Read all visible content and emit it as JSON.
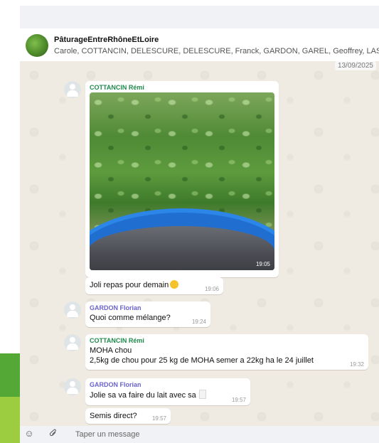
{
  "header": {
    "group_name": "PâturageEntreRhôneEtLoire",
    "members": "Carole, COTTANCIN, DELESCURE, DELESCURE, Franck, GARDON, GAREL, Geoffrey, LASS"
  },
  "chat": {
    "date": "13/09/2025",
    "messages": [
      {
        "sender": "COTTANCIN Rémi",
        "sender_color": "#1f8a4c",
        "photo_time": "19:05"
      },
      {
        "text": "Joli repas pour demain",
        "emoji": "sad-face-emoji",
        "time": "19:06"
      },
      {
        "sender": "GARDON Florian",
        "sender_color": "#6b63c9",
        "text": "Quoi comme mélange?",
        "time": "19:24"
      },
      {
        "sender": "COTTANCIN Rémi",
        "sender_color": "#1f8a4c",
        "line1": "MOHA chou",
        "line2": "2,5kg de chou pour 25 kg de MOHA semer a 22kg ha le 24 juillet",
        "time": "19:32"
      },
      {
        "sender": "GARDON Florian",
        "sender_color": "#6b63c9",
        "text": "Jolie sa va faire du lait avec  sa",
        "time": "19:57"
      },
      {
        "text": "Semis direct?",
        "time": "19:57"
      }
    ]
  },
  "composer": {
    "placeholder": "Taper un message",
    "icons": [
      "emoji-icon",
      "paperclip-icon"
    ]
  },
  "colors": {
    "chat_background": "#efeae2",
    "accent_dark": "#54a836",
    "accent_light": "#9ccd41"
  }
}
